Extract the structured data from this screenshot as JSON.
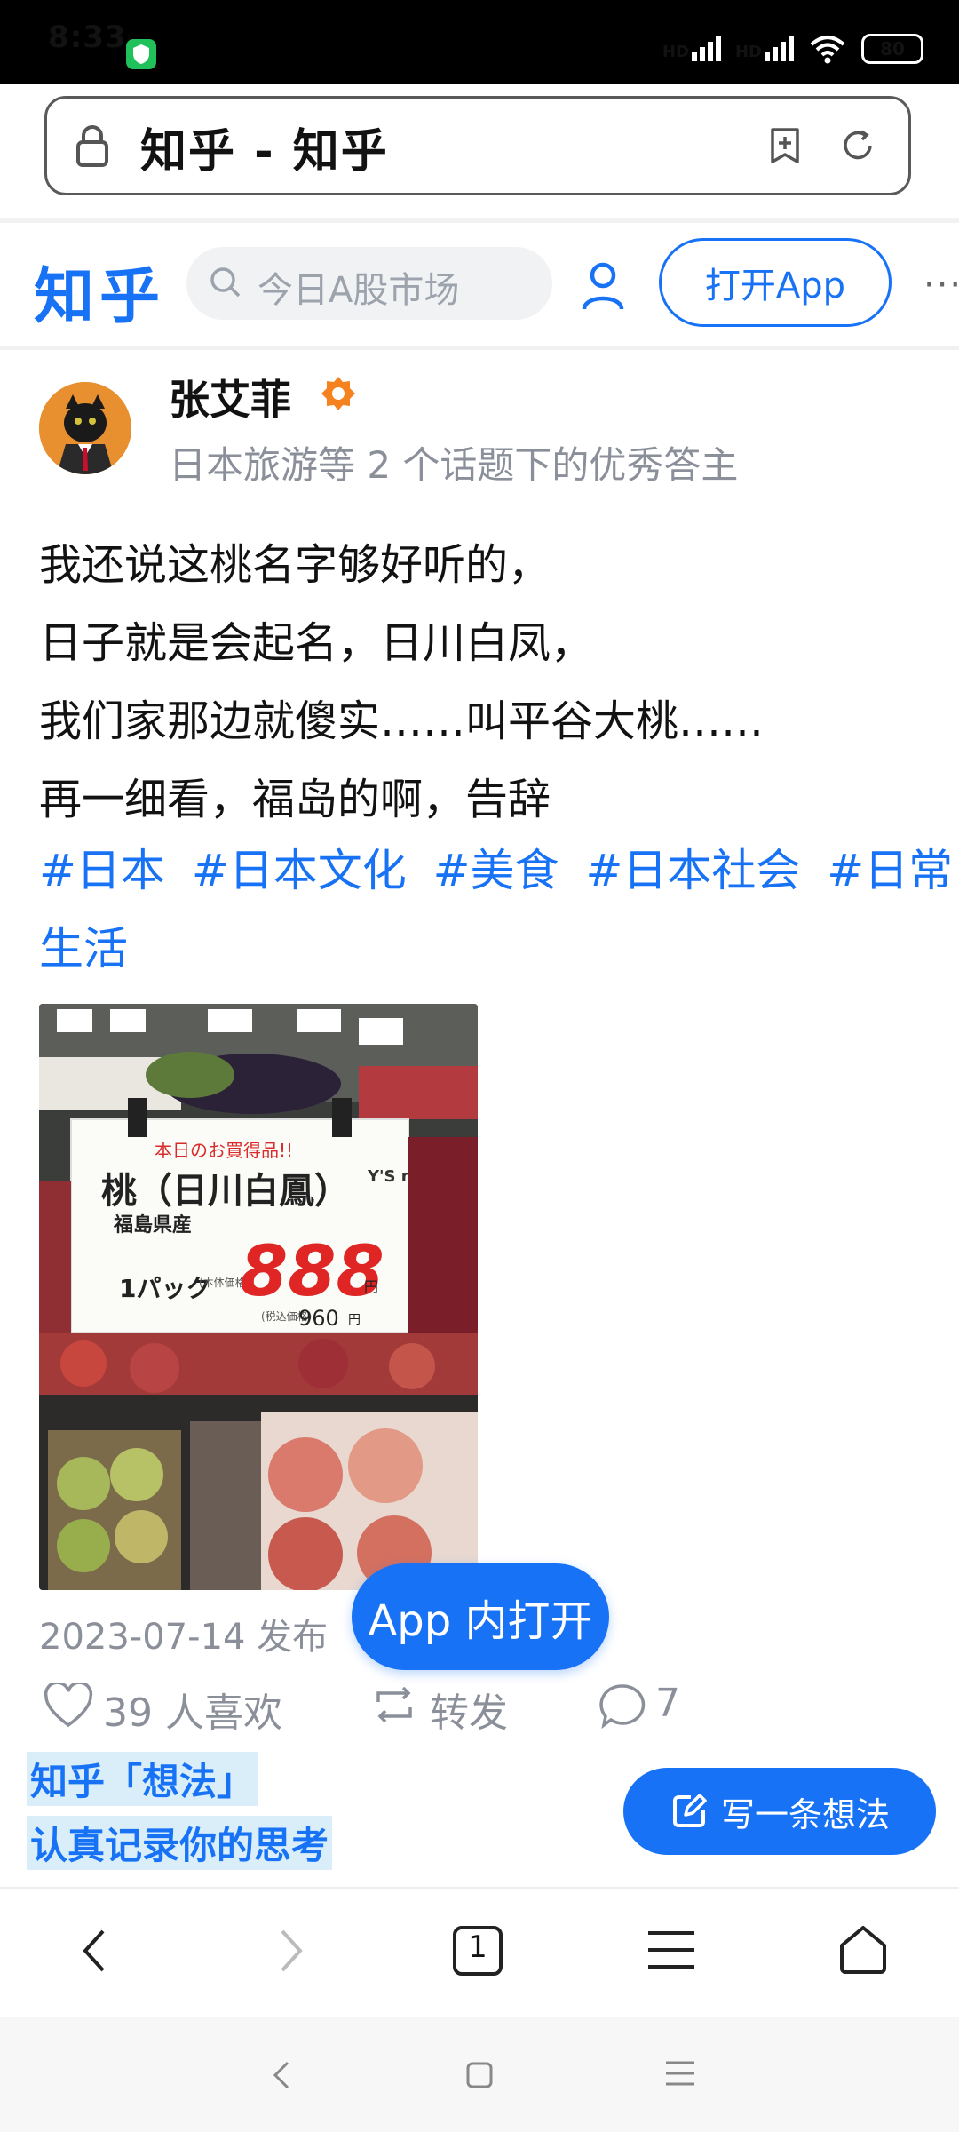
{
  "status": {
    "time": "8:33",
    "signal1": "HD",
    "signal2": "HD",
    "battery": "80"
  },
  "browser": {
    "page_title": "知乎 - 知乎"
  },
  "header": {
    "logo": "知乎",
    "search_placeholder": "今日A股市场",
    "open_app_label": "打开App",
    "more_label": "···"
  },
  "author": {
    "name": "张艾菲",
    "description": "日本旅游等 2 个话题下的优秀答主"
  },
  "post": {
    "lines": [
      "我还说这桃名字够好听的，",
      "日子就是会起名，日川白凤，",
      "我们家那边就傻实……叫平谷大桃……",
      "再一细看，福岛的啊，告辞"
    ],
    "tags": [
      "#日本",
      "#日本文化",
      "#美食",
      "#日本社会",
      "#日常"
    ],
    "tags_wrap": "生活",
    "date": "2023-07-14 发布",
    "sign": {
      "top": "本日のお買得品!!",
      "brand": "Y'S mart",
      "name": "桃（日川白鳳）",
      "origin": "福島県産",
      "unit": "1パック",
      "price_label": "(本体価格)",
      "price": "888",
      "yen": "円",
      "tax_label": "(税込価格)",
      "tax_price": "960",
      "tax_yen": "円"
    }
  },
  "float_button": "App 内打开",
  "actions": {
    "likes": "39 人喜欢",
    "repost": "转发",
    "comments": "7"
  },
  "promo": {
    "line1": "知乎「想法」",
    "line2": "认真记录你的思考",
    "write_button": "写一条想法"
  },
  "browser_nav": {
    "tab_count": "1"
  },
  "colors": {
    "brand": "#1772f6",
    "secondary_text": "#8a8f99"
  }
}
